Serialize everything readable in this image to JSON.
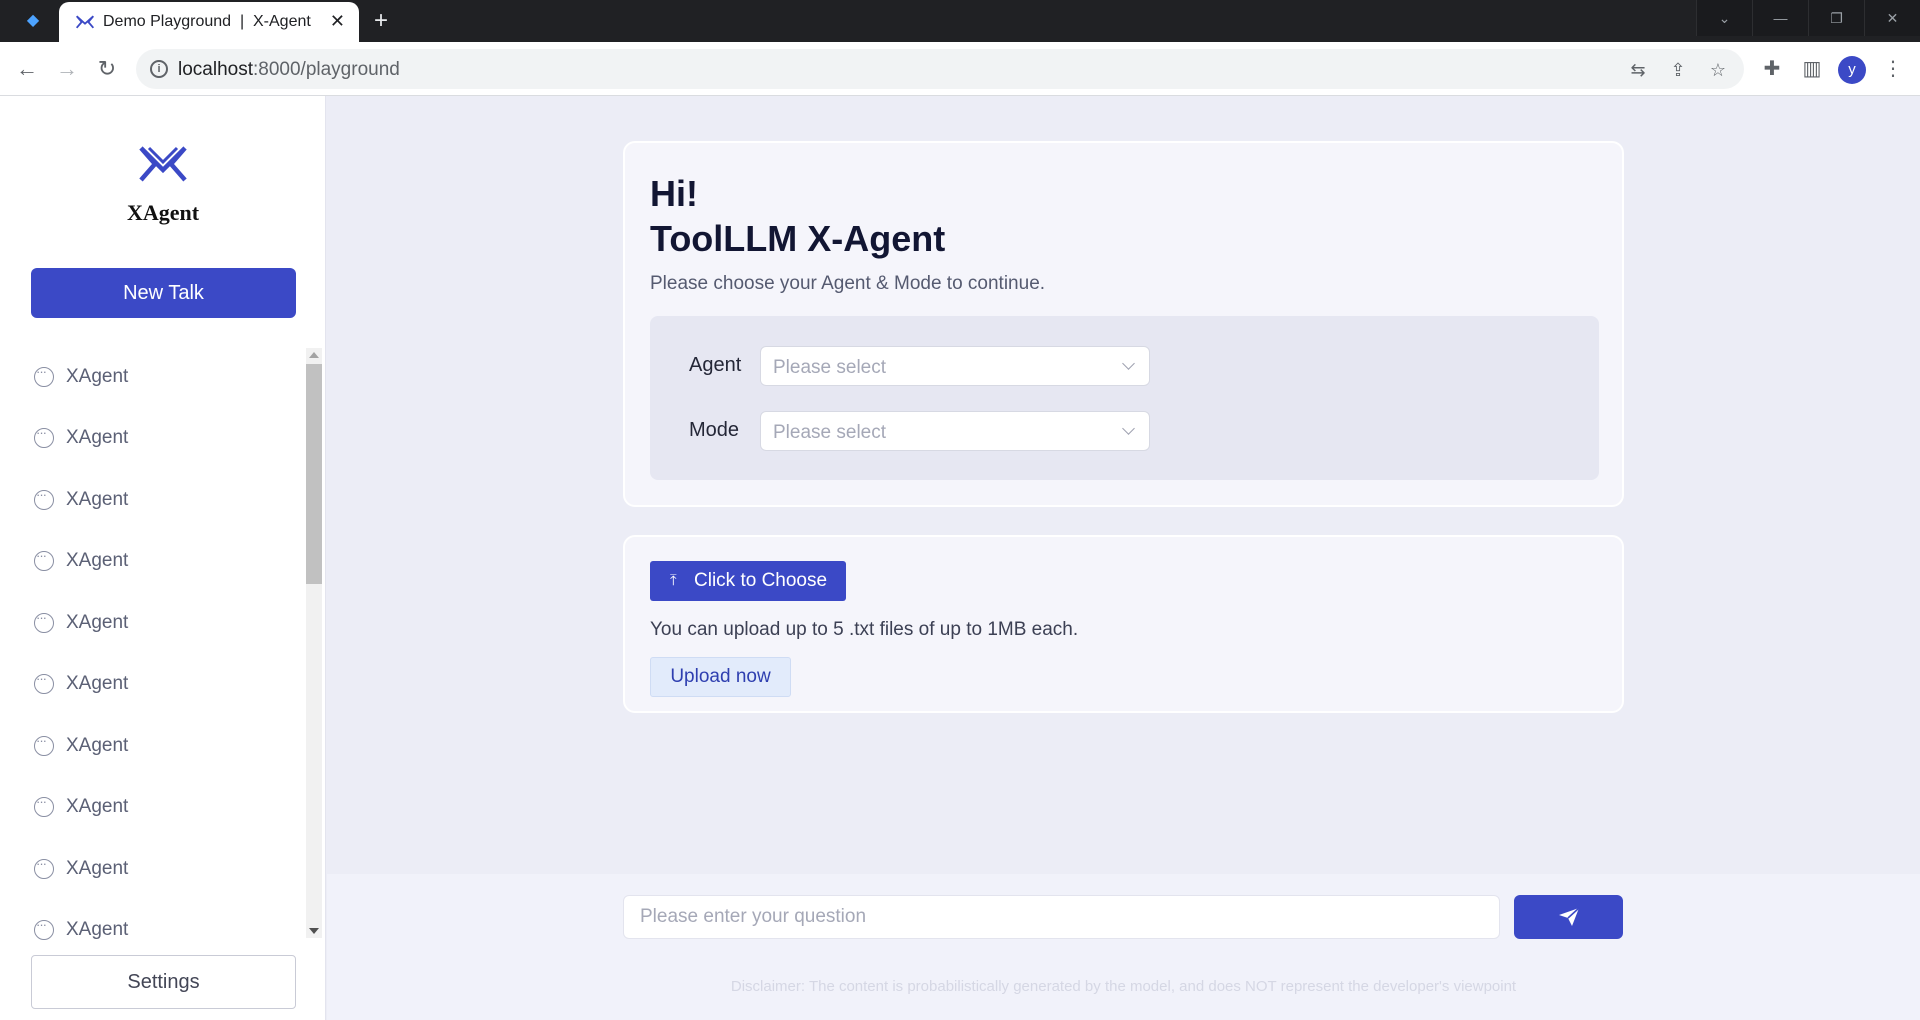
{
  "browser": {
    "tab_title": "Demo Playground  |  X-Agent",
    "tab_close": "✕",
    "new_tab": "+",
    "url_host": "localhost",
    "url_path": ":8000/playground",
    "profile_initial": "y"
  },
  "sidebar": {
    "brand": "XAgent",
    "new_talk_label": "New Talk",
    "items": [
      {
        "label": "XAgent"
      },
      {
        "label": "XAgent"
      },
      {
        "label": "XAgent"
      },
      {
        "label": "XAgent"
      },
      {
        "label": "XAgent"
      },
      {
        "label": "XAgent"
      },
      {
        "label": "XAgent"
      },
      {
        "label": "XAgent"
      },
      {
        "label": "XAgent"
      },
      {
        "label": "XAgent"
      }
    ],
    "settings_label": "Settings"
  },
  "welcome": {
    "greeting": "Hi!",
    "title": "ToolLLM X-Agent",
    "subtitle": "Please choose your Agent & Mode to continue.",
    "agent_label": "Agent",
    "agent_placeholder": "Please select",
    "mode_label": "Mode",
    "mode_placeholder": "Please select"
  },
  "upload": {
    "choose_label": "Click to Choose",
    "hint": "You can upload up to 5 .txt files of up to 1MB each.",
    "upload_now_label": "Upload now"
  },
  "composer": {
    "placeholder": "Please enter your question",
    "disclaimer": "Disclaimer: The content is probabilistically generated by the model, and does NOT represent the developer's viewpoint"
  },
  "colors": {
    "accent": "#3b49c6",
    "background": "#ecedf6"
  }
}
